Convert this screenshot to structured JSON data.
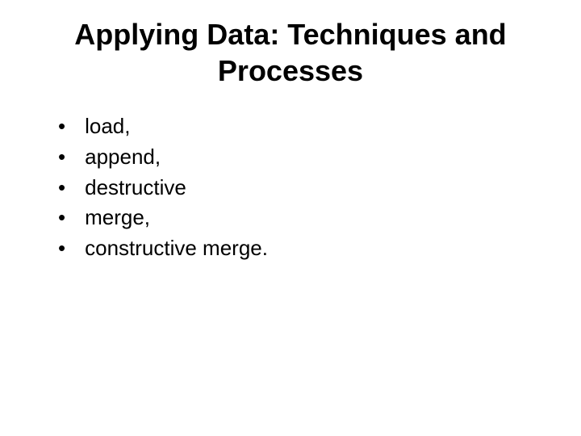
{
  "title": "Applying Data: Techniques and Processes",
  "bullets": [
    "load,",
    "append,",
    "destructive",
    "merge,",
    "constructive merge."
  ]
}
